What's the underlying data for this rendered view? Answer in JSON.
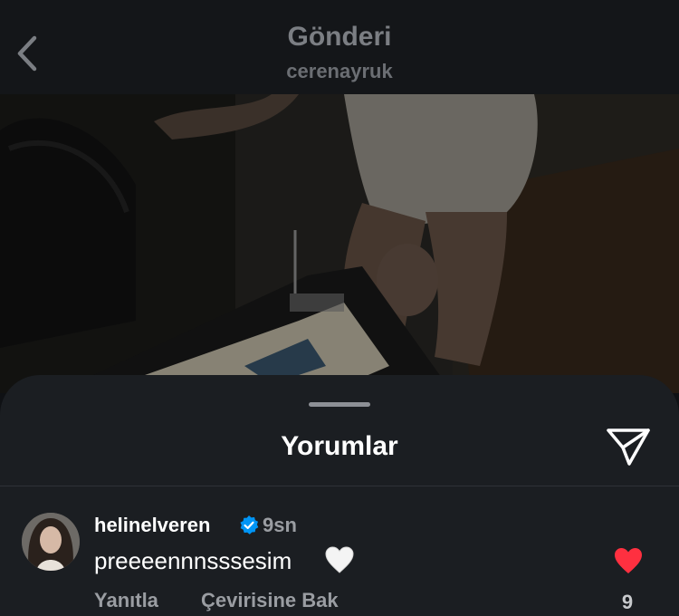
{
  "header": {
    "title": "Gönderi",
    "username": "cerenayruk",
    "back_icon": "chevron-left-icon"
  },
  "sheet": {
    "title": "Yorumlar",
    "share_icon": "send-icon"
  },
  "comments": [
    {
      "username": "helinelveren",
      "verified": true,
      "time": "9sn",
      "text": "preeeennnsssesim",
      "text_emoji": "white-heart-icon",
      "reply_label": "Yanıtla",
      "translate_label": "Çevirisine Bak",
      "like_count": "9",
      "liked": true
    }
  ],
  "colors": {
    "accent_like": "#ff3040",
    "verified_blue": "#0095f6",
    "background": "#1b1e22"
  }
}
